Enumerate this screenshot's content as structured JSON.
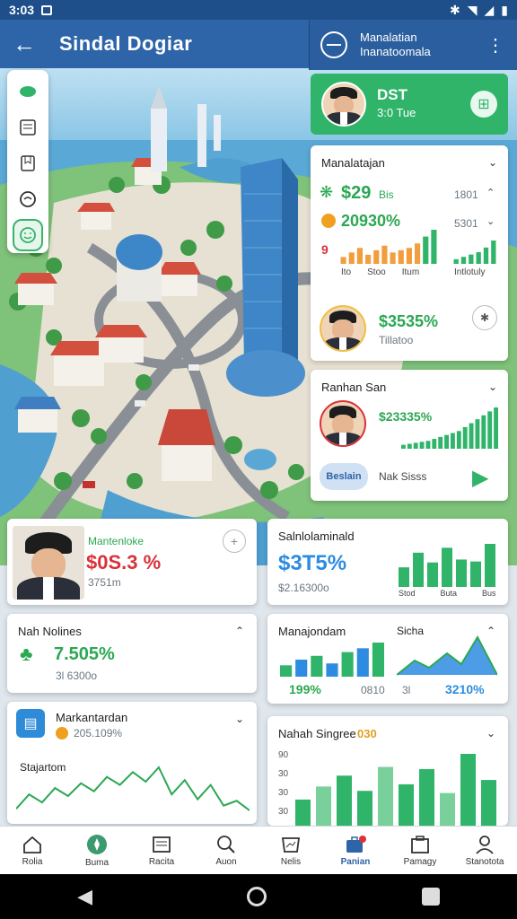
{
  "status": {
    "time": "3:03"
  },
  "appbar": {
    "title": "Sindal Dogiar"
  },
  "panel": {
    "header_line1": "Manalatian",
    "header_line2": "Inanatoomala",
    "profile": {
      "title": "DST",
      "subtitle": "3:0 Tue"
    },
    "card1": {
      "title": "Manalatajan",
      "value1": "$29",
      "value1_suffix": "Bis",
      "value2": "20930%",
      "value3_label": "9",
      "right_top": "1801",
      "right_mid": "5301",
      "tick_labels": [
        "Ito",
        "Stoo",
        "Itum"
      ],
      "right_tick": "Intlotuly",
      "bars": [
        6,
        10,
        14,
        8,
        12,
        16,
        10,
        12,
        14,
        18,
        24,
        30
      ],
      "bars_right": [
        4,
        6,
        8,
        10,
        14,
        20
      ]
    },
    "card1_row": {
      "value": "$3535%",
      "sub": "Tillatoo"
    },
    "card2": {
      "title": "Ranhan San",
      "value": "$23335%",
      "bars": [
        4,
        5,
        6,
        7,
        8,
        10,
        12,
        14,
        16,
        18,
        22,
        26,
        30,
        34,
        38,
        42
      ],
      "button": "Beslain",
      "button_label": "Nak Sisss"
    }
  },
  "cards": {
    "person": {
      "title": "Mantenloke",
      "value": "$0S.3 %",
      "sub": "3751m"
    },
    "salary": {
      "title": "Salnlolaminald",
      "value": "$3T5%",
      "sub": "$2.16300o",
      "ticks": [
        "Stod",
        "Buta",
        "Bus"
      ],
      "bars": [
        20,
        35,
        25,
        40,
        28,
        26,
        44
      ]
    },
    "rate": {
      "title": "Nah Nolines",
      "value": "7.505%",
      "sub": "3l 6300o"
    },
    "manajondam": {
      "title": "Manajondam",
      "title2": "Sicha",
      "value": "199%",
      "sub": "0810",
      "value2": "3210%",
      "sub2": "3l",
      "bars": [
        12,
        18,
        22,
        14,
        26,
        30,
        36
      ]
    },
    "markant": {
      "title": "Markantardan",
      "value": "205.109%",
      "section": "Stajartom",
      "line": [
        40,
        58,
        48,
        66,
        56,
        72,
        62,
        80,
        70,
        86,
        74,
        92,
        58,
        76,
        52,
        70,
        44,
        50,
        38
      ]
    },
    "nahah": {
      "title": "Nahah Singree",
      "title_accent": "030",
      "yticks": [
        "90",
        "30",
        "30",
        "30"
      ],
      "bars": [
        24,
        36,
        46,
        32,
        54,
        38,
        52,
        30,
        66,
        42
      ]
    }
  },
  "bottom_nav": [
    {
      "label": "Rolia",
      "icon": "home-icon"
    },
    {
      "label": "Buma",
      "icon": "compass-icon"
    },
    {
      "label": "Racita",
      "icon": "document-icon"
    },
    {
      "label": "Auon",
      "icon": "search-icon"
    },
    {
      "label": "Nelis",
      "icon": "chart-icon"
    },
    {
      "label": "Panian",
      "icon": "briefcase-icon",
      "active": true
    },
    {
      "label": "Pamagy",
      "icon": "map-icon"
    },
    {
      "label": "Stanotota",
      "icon": "user-icon"
    }
  ],
  "colors": {
    "primary": "#2e64a8",
    "green": "#2fb46a",
    "red": "#d9323a",
    "blue": "#2d8ce0"
  }
}
